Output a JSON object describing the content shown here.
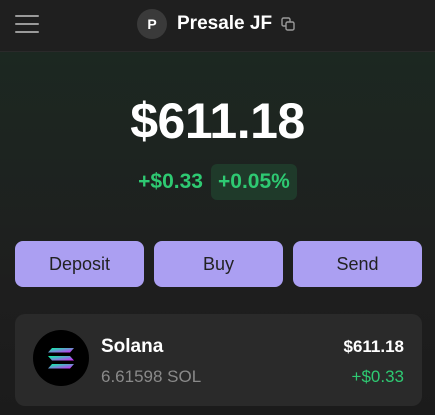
{
  "header": {
    "menu_icon": "hamburger-menu-icon",
    "avatar_letter": "P",
    "account_name": "Presale JF",
    "copy_icon": "copy-icon"
  },
  "portfolio": {
    "balance": "$611.18",
    "change_amount": "+$0.33",
    "change_percent": "+0.05%"
  },
  "actions": [
    {
      "label": "Deposit"
    },
    {
      "label": "Buy"
    },
    {
      "label": "Send"
    }
  ],
  "tokens": [
    {
      "name": "Solana",
      "amount": "6.61598 SOL",
      "value": "$611.18",
      "change": "+$0.33",
      "icon": "solana-logo-icon"
    }
  ],
  "colors": {
    "accent": "#ab9ff2",
    "positive": "#2ec972",
    "background": "#1f1f1f",
    "card": "#2a2a2a"
  }
}
